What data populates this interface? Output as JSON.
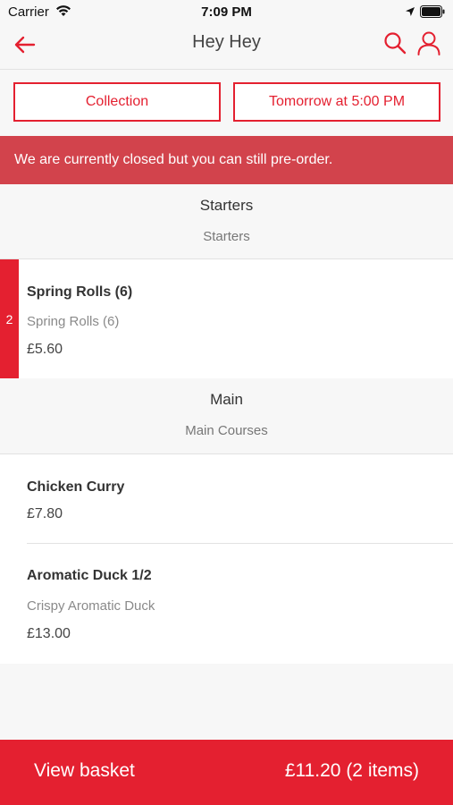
{
  "status_bar": {
    "carrier": "Carrier",
    "time": "7:09 PM"
  },
  "nav": {
    "title": "Hey Hey"
  },
  "order_options": {
    "collection_label": "Collection",
    "time_label": "Tomorrow at 5:00 PM"
  },
  "banner": {
    "text": "We are currently closed but you can still pre-order."
  },
  "categories": [
    {
      "name": "Starters",
      "subtitle": "Starters",
      "items": [
        {
          "name": "Spring Rolls (6)",
          "description": "Spring Rolls (6)",
          "price": "£5.60",
          "quantity": "2"
        }
      ]
    },
    {
      "name": "Main",
      "subtitle": "Main Courses",
      "items": [
        {
          "name": "Chicken Curry",
          "price": "£7.80"
        },
        {
          "name": "Aromatic Duck 1/2",
          "description": "Crispy Aromatic Duck",
          "price": "£13.00"
        }
      ]
    }
  ],
  "basket": {
    "label": "View basket",
    "total": "£11.20 (2 items)"
  },
  "colors": {
    "accent": "#e42030",
    "banner": "#d2434c",
    "background": "#f7f7f7"
  }
}
